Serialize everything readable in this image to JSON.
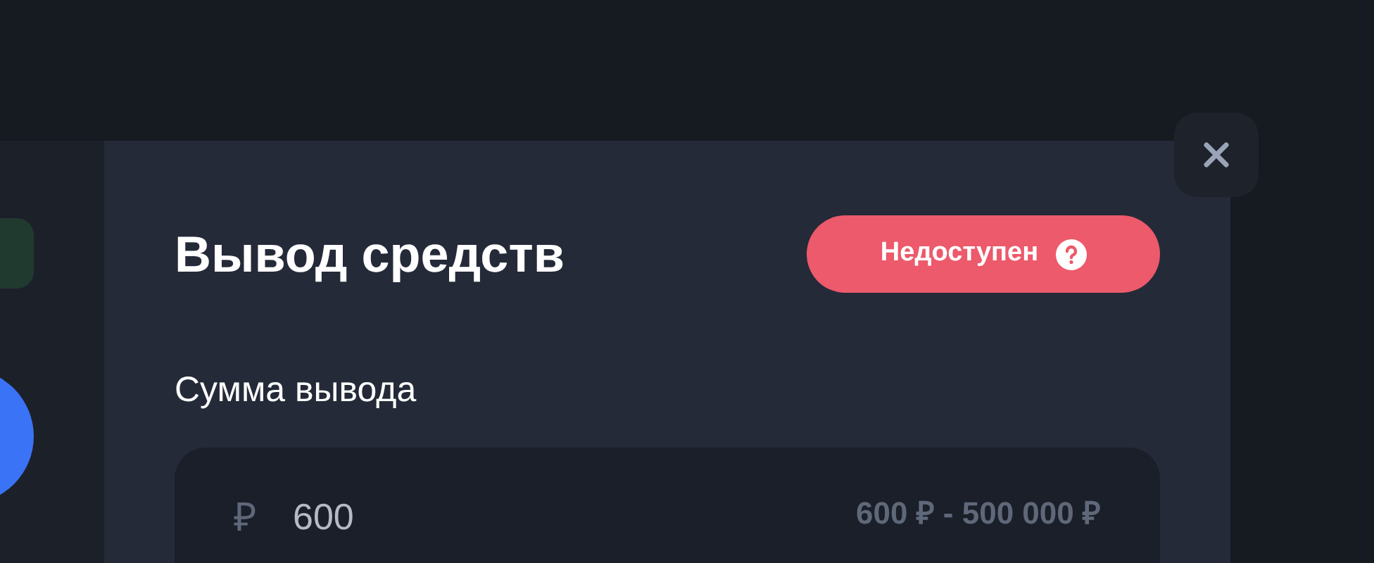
{
  "modal": {
    "title": "Вывод средств",
    "status_badge": {
      "label": "Недоступен",
      "available": false
    },
    "amount_field": {
      "label": "Сумма вывода",
      "currency": "₽",
      "value": "600",
      "range": "600 ₽ - 500 000 ₽"
    }
  }
}
